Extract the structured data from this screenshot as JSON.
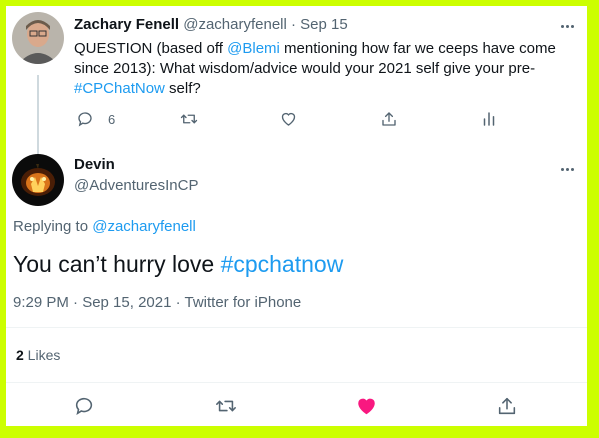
{
  "parent_tweet": {
    "author_name": "Zachary Fenell",
    "handle": "@zacharyfenell",
    "separator": "·",
    "date": "Sep 15",
    "text_1": "QUESTION (based off ",
    "mention": "@Blemi",
    "text_2": " mentioning how far we ceeps have come since 2013): What wisdom/advice would your 2021 self give your pre-",
    "hashtag": "#CPChatNow",
    "text_3": " self?",
    "reply_count": "6"
  },
  "reply_tweet": {
    "author_name": "Devin",
    "handle": "@AdventuresInCP",
    "replying_to_label": "Replying to ",
    "replying_to_handle": "@zacharyfenell",
    "text_main": "You can’t hurry love ",
    "hashtag": "#cpchatnow",
    "timestamp": "9:29 PM · Sep 15, 2021 · Twitter for iPhone",
    "likes_count": "2",
    "likes_label": " Likes"
  },
  "colors": {
    "accent": "#1d9bf0",
    "like": "#f91880",
    "border": "#ccff00"
  },
  "icons": [
    "reply-icon",
    "retweet-icon",
    "like-icon",
    "share-icon",
    "analytics-icon",
    "more-icon"
  ]
}
